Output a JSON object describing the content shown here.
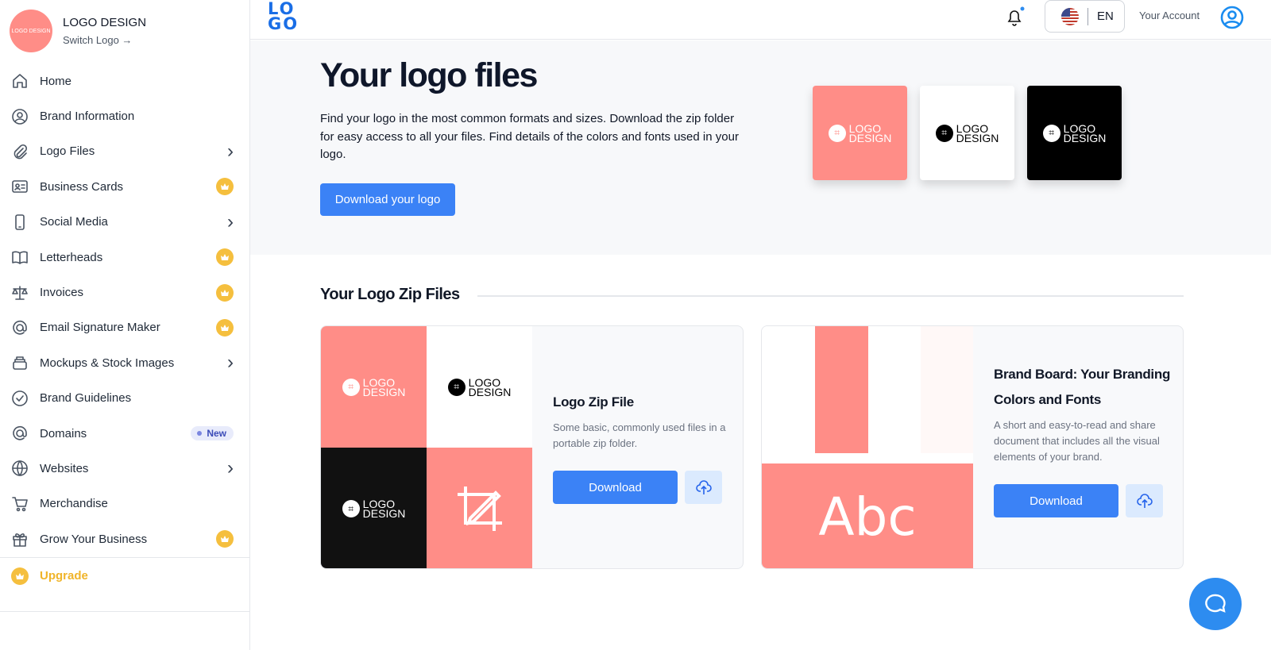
{
  "sidebar": {
    "brand": {
      "name": "LOGO DESIGN",
      "switch_label": "Switch Logo →",
      "avatar_text": "LOGO DESIGN"
    },
    "items": [
      {
        "label": "Home",
        "icon": "home-icon",
        "right": ""
      },
      {
        "label": "Brand Information",
        "icon": "user-circle-icon",
        "right": ""
      },
      {
        "label": "Logo Files",
        "icon": "paperclip-icon",
        "right": "chevron"
      },
      {
        "label": "Business Cards",
        "icon": "id-card-icon",
        "right": "crown"
      },
      {
        "label": "Social Media",
        "icon": "phone-icon",
        "right": "chevron"
      },
      {
        "label": "Letterheads",
        "icon": "book-icon",
        "right": "crown"
      },
      {
        "label": "Invoices",
        "icon": "scale-icon",
        "right": "crown"
      },
      {
        "label": "Email Signature Maker",
        "icon": "at-icon",
        "right": "crown"
      },
      {
        "label": "Mockups & Stock Images",
        "icon": "layers-icon",
        "right": "chevron"
      },
      {
        "label": "Brand Guidelines",
        "icon": "check-badge-icon",
        "right": ""
      },
      {
        "label": "Domains",
        "icon": "at-icon",
        "right": "new"
      },
      {
        "label": "Websites",
        "icon": "globe-icon",
        "right": "chevron"
      },
      {
        "label": "Merchandise",
        "icon": "cart-icon",
        "right": ""
      },
      {
        "label": "Grow Your Business",
        "icon": "gift-icon",
        "right": "crown"
      }
    ],
    "new_badge": "New",
    "upgrade_label": "Upgrade"
  },
  "topbar": {
    "logo_text": "LOGO",
    "language": "EN",
    "account_label": "Your Account"
  },
  "hero": {
    "title": "Your logo files",
    "description": "Find your logo in the most common formats and sizes. Download the zip folder for easy access to all your files. Find details of the colors and fonts used in your logo.",
    "download_button": "Download your logo",
    "logo_text_line1": "LOGO",
    "logo_text_line2": "DESIGN"
  },
  "zip_section": {
    "title": "Your Logo Zip Files",
    "cards": [
      {
        "title": "Logo Zip File",
        "description": "Some basic, commonly used files in a portable zip folder.",
        "download_label": "Download"
      },
      {
        "title": "Brand Board: Your Branding Colors and Fonts",
        "description": "A short and easy-to-read and share document that includes all the visual elements of your brand.",
        "download_label": "Download",
        "preview_text": "Abc"
      }
    ]
  },
  "colors": {
    "accent": "#3b82f6",
    "brand_coral": "#ff8d87",
    "crown": "#f5bf3e",
    "upgrade": "#f0b429"
  }
}
